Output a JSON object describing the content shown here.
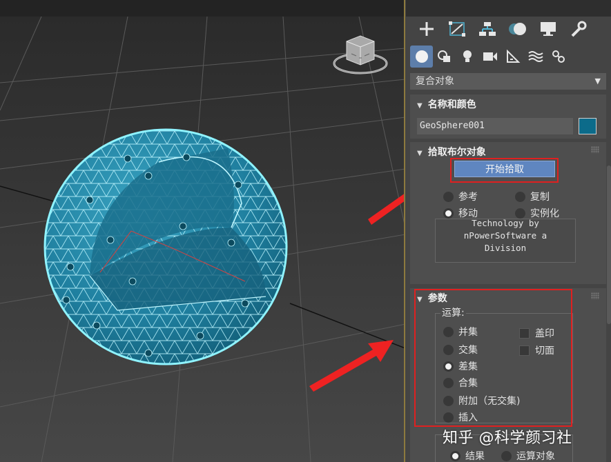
{
  "panel": {
    "top_tabs": [
      "create-icon",
      "modify-icon",
      "hierarchy-icon",
      "motion-icon",
      "display-icon",
      "utilities-icon"
    ],
    "sub_tabs": [
      "geometry-icon",
      "shapes-icon",
      "lights-icon",
      "cameras-icon",
      "helpers-icon",
      "spacewarps-icon",
      "systems-icon"
    ],
    "category_dropdown": "复合对象",
    "name_color": {
      "title": "名称和颜色",
      "object_name": "GeoSphere001",
      "color": "#0c6b8a"
    },
    "pick_boolean": {
      "title": "拾取布尔对象",
      "start_pick_label": "开始拾取",
      "options": [
        {
          "label": "参考",
          "selected": false
        },
        {
          "label": "复制",
          "selected": false
        },
        {
          "label": "移动",
          "selected": true
        },
        {
          "label": "实例化",
          "selected": false
        }
      ],
      "tech_text": [
        "Technology by",
        "nPowerSoftware a",
        "Division"
      ]
    },
    "parameters": {
      "title": "参数",
      "operation_label": "运算:",
      "operations": [
        {
          "label": "并集",
          "selected": false
        },
        {
          "label": "交集",
          "selected": false
        },
        {
          "label": "差集",
          "selected": true
        },
        {
          "label": "合集",
          "selected": false
        },
        {
          "label": "附加（无交集)",
          "selected": false
        },
        {
          "label": "插入",
          "selected": false
        }
      ],
      "checkboxes": [
        {
          "label": "盖印",
          "checked": false
        },
        {
          "label": "切面",
          "checked": false
        }
      ],
      "output_options": [
        {
          "label": "结果",
          "selected": true
        },
        {
          "label": "运算对象",
          "selected": false
        }
      ]
    }
  },
  "watermark": "知乎 @科学颜习社",
  "colors": {
    "accent_blue": "#5f86c0",
    "wire_cyan": "#8ff3ff",
    "highlight_red": "#e02020"
  }
}
